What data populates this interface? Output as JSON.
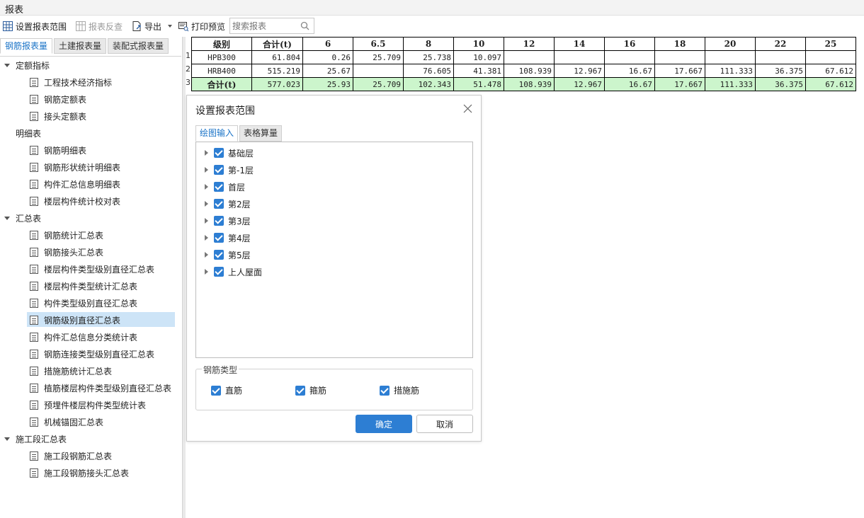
{
  "window": {
    "title": "报表"
  },
  "toolbar": {
    "set_range": "设置报表范围",
    "reverse_check": "报表反查",
    "export": "导出",
    "print_preview": "打印预览",
    "search_placeholder": "搜索报表"
  },
  "left_tabs": [
    "钢筋报表量",
    "土建报表量",
    "装配式报表量"
  ],
  "tree": {
    "g1": {
      "label": "定额指标",
      "items": [
        "工程技术经济指标",
        "钢筋定额表",
        "接头定额表"
      ]
    },
    "g2": {
      "label": "明细表",
      "items": [
        "钢筋明细表",
        "钢筋形状统计明细表",
        "构件汇总信息明细表",
        "楼层构件统计校对表"
      ]
    },
    "g3": {
      "label": "汇总表",
      "items": [
        "钢筋统计汇总表",
        "钢筋接头汇总表",
        "楼层构件类型级别直径汇总表",
        "楼层构件类型统计汇总表",
        "构件类型级别直径汇总表",
        "钢筋级别直径汇总表",
        "构件汇总信息分类统计表",
        "钢筋连接类型级别直径汇总表",
        "措施筋统计汇总表",
        "植筋楼层构件类型级别直径汇总表",
        "预埋件楼层构件类型统计表",
        "机械锚固汇总表"
      ]
    },
    "g4": {
      "label": "施工段汇总表",
      "items": [
        "施工段钢筋汇总表",
        "施工段钢筋接头汇总表"
      ]
    }
  },
  "report": {
    "headers": [
      "级别",
      "合计(t)",
      "6",
      "6.5",
      "8",
      "10",
      "12",
      "14",
      "16",
      "18",
      "20",
      "22",
      "25"
    ],
    "row_numbers": [
      "1",
      "2",
      "3"
    ],
    "rows": [
      [
        "HPB300",
        "61.804",
        "0.26",
        "25.709",
        "25.738",
        "10.097",
        "",
        "",
        "",
        "",
        "",
        "",
        ""
      ],
      [
        "HRB400",
        "515.219",
        "25.67",
        "",
        "76.605",
        "41.381",
        "108.939",
        "12.967",
        "16.67",
        "17.667",
        "111.333",
        "36.375",
        "67.612"
      ],
      [
        "合计(t)",
        "577.023",
        "25.93",
        "25.709",
        "102.343",
        "51.478",
        "108.939",
        "12.967",
        "16.67",
        "17.667",
        "111.333",
        "36.375",
        "67.612"
      ]
    ]
  },
  "dialog": {
    "title": "设置报表范围",
    "tabs": [
      "绘图输入",
      "表格算量"
    ],
    "floors": [
      "基础层",
      "第-1层",
      "首层",
      "第2层",
      "第3层",
      "第4层",
      "第5层",
      "上人屋面"
    ],
    "rebar_type_legend": "钢筋类型",
    "rebar_types": [
      "直筋",
      "箍筋",
      "措施筋"
    ],
    "ok": "确定",
    "cancel": "取消"
  },
  "colors": {
    "accent": "#2d7ed3",
    "selected": "#cde4f7",
    "total_row": "#ccf5cc"
  }
}
